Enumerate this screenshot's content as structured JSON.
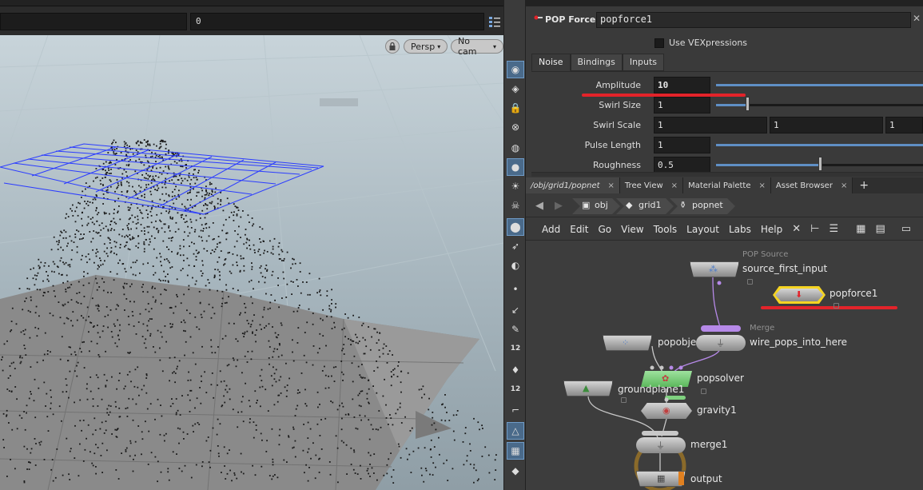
{
  "viewport": {
    "frame_field_value": "0",
    "camera_mode": "Persp",
    "camera_select": "No cam",
    "caret": "▾"
  },
  "toolbar": {
    "numbers": [
      "12",
      "12"
    ]
  },
  "parameters": {
    "node_type": "POP Force",
    "node_name": "popforce1",
    "close_glyph": "✕",
    "vexpressions_label": "Use VEXpressions",
    "tabs": [
      "Noise",
      "Bindings",
      "Inputs"
    ],
    "active_tab": "Noise",
    "params": [
      {
        "label": "Amplitude",
        "value": "10"
      },
      {
        "label": "Swirl Size",
        "value": "1"
      },
      {
        "label": "Swirl Scale",
        "values": [
          "1",
          "1",
          "1"
        ]
      },
      {
        "label": "Pulse Length",
        "value": "1"
      },
      {
        "label": "Roughness",
        "value": "0.5"
      }
    ],
    "slider_levels": {
      "amplitude": 1.0,
      "swirl_size": 0.15,
      "pulse_length": 1.0,
      "roughness": 0.5
    }
  },
  "pane_tabs": [
    {
      "label": "/obj/grid1/popnet",
      "close": "×"
    },
    {
      "label": "Tree View",
      "close": "×"
    },
    {
      "label": "Material Palette",
      "close": "×"
    },
    {
      "label": "Asset Browser",
      "close": "×"
    }
  ],
  "add_pane": "+",
  "path": {
    "back": "◀",
    "forward": "▶",
    "crumbs": [
      "obj",
      "grid1",
      "popnet"
    ]
  },
  "network_menu": [
    "Add",
    "Edit",
    "Go",
    "View",
    "Tools",
    "Layout",
    "Labs",
    "Help"
  ],
  "network": {
    "nodes": {
      "source_first_input": {
        "label": "source_first_input",
        "sublabel": "POP Source"
      },
      "popforce1": {
        "label": "popforce1"
      },
      "popobject": {
        "label": "popobje"
      },
      "wire_pops_into_here": {
        "label": "wire_pops_into_here",
        "sublabel": "Merge"
      },
      "popsolver": {
        "label": "popsolver"
      },
      "groundplane1": {
        "label": "groundplane1"
      },
      "gravity1": {
        "label": "gravity1"
      },
      "merge1": {
        "label": "merge1"
      },
      "output": {
        "label": "output"
      }
    }
  },
  "colors": {
    "accent_blue": "#5f8fc5",
    "highlight_red": "#e3232a",
    "selected_yellow": "#f5d422",
    "solver_green": "#7fd17f",
    "merge_purple": "#b689e8",
    "grid_blue": "#2b3cff"
  }
}
